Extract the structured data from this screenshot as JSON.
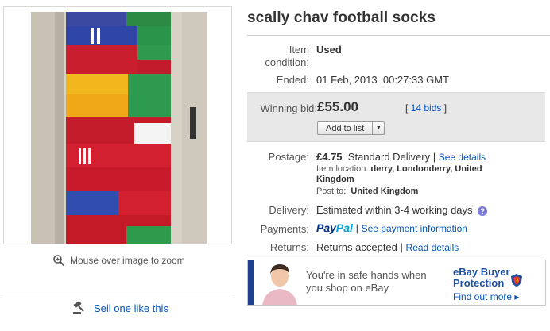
{
  "item": {
    "title": "scally chav football socks"
  },
  "left": {
    "zoom_text": "Mouse over image to zoom",
    "sell_link": "Sell one like this"
  },
  "details": {
    "condition_label_1": "Item",
    "condition_label_2": "condition:",
    "condition_value": "Used",
    "ended_label": "Ended:",
    "ended_date": "01 Feb, 2013",
    "ended_time": "00:27:33 GMT"
  },
  "bid": {
    "label": "Winning bid:",
    "amount": "£55.00",
    "bids_open": "[",
    "bids_link": "14 bids",
    "bids_close": "]",
    "add_to_list": "Add to list"
  },
  "postage": {
    "label": "Postage:",
    "price": "£4.75",
    "method": "Standard Delivery",
    "separator": "|",
    "see_details": "See details",
    "location_label": "Item location:",
    "location_line1": "derry, Londonderry, United",
    "location_line2": "Kingdom",
    "postto_label": "Post to:",
    "postto_value": "United Kingdom"
  },
  "delivery": {
    "label": "Delivery:",
    "value": "Estimated within 3-4 working days",
    "help": "?"
  },
  "payments": {
    "label": "Payments:",
    "paypal_1": "Pay",
    "paypal_2": "Pal",
    "separator": "|",
    "link": "See payment information"
  },
  "returns": {
    "label": "Returns:",
    "value": "Returns accepted",
    "separator": "|",
    "link": "Read details"
  },
  "banner": {
    "line1": "You're in safe hands when",
    "line2": "you shop on eBay",
    "title1": "eBay Buyer",
    "title2": "Protection",
    "more": "Find out more ▸"
  },
  "colors": {
    "link": "#0654ba",
    "bidbox_bg": "#e8e8e8",
    "banner_blue": "#1f3f8f"
  },
  "icons": [
    "zoom-icon",
    "gavel-icon",
    "help-icon",
    "shield-icon",
    "dropdown-caret-icon"
  ]
}
